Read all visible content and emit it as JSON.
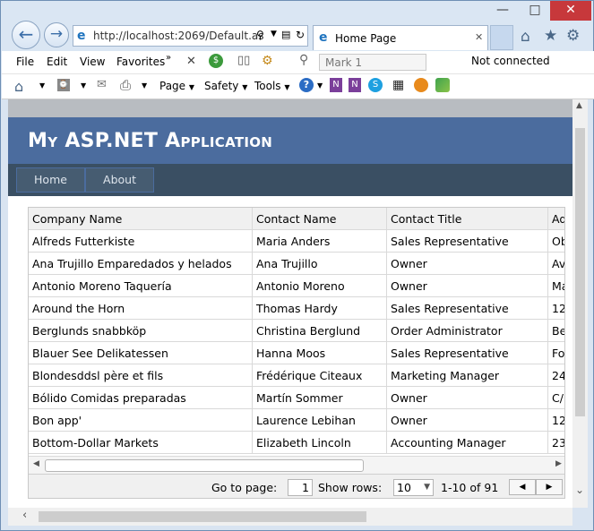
{
  "browser": {
    "address": "http://localhost:2069/Default.as",
    "tab_title": "Home Page",
    "menu": [
      "File",
      "Edit",
      "View",
      "Favorites"
    ],
    "mark_placeholder": "Mark 1",
    "status": "Not connected",
    "cmd": {
      "page": "Page",
      "safety": "Safety",
      "tools": "Tools"
    }
  },
  "app": {
    "title": "My ASP.NET Application",
    "nav": [
      "Home",
      "About"
    ]
  },
  "grid": {
    "headers": [
      "Company Name",
      "Contact Name",
      "Contact Title",
      "Ad"
    ],
    "rows": [
      [
        "Alfreds Futterkiste",
        "Maria Anders",
        "Sales Representative",
        "Ob"
      ],
      [
        "Ana Trujillo Emparedados y helados",
        "Ana Trujillo",
        "Owner",
        "Av"
      ],
      [
        "Antonio Moreno Taquería",
        "Antonio Moreno",
        "Owner",
        "Ma"
      ],
      [
        "Around the Horn",
        "Thomas Hardy",
        "Sales Representative",
        "12"
      ],
      [
        "Berglunds snabbköp",
        "Christina Berglund",
        "Order Administrator",
        "Be"
      ],
      [
        "Blauer See Delikatessen",
        "Hanna Moos",
        "Sales Representative",
        "Fo"
      ],
      [
        "Blondesddsl père et fils",
        "Frédérique Citeaux",
        "Marketing Manager",
        "24"
      ],
      [
        "Bólido Comidas preparadas",
        "Martín Sommer",
        "Owner",
        "C/"
      ],
      [
        "Bon app'",
        "Laurence Lebihan",
        "Owner",
        "12"
      ],
      [
        "Bottom-Dollar Markets",
        "Elizabeth Lincoln",
        "Accounting Manager",
        "23"
      ]
    ],
    "pager": {
      "goto_label": "Go to page:",
      "page_value": "1",
      "show_rows_label": "Show rows:",
      "rows_value": "10",
      "range": "1-10 of 91"
    }
  }
}
